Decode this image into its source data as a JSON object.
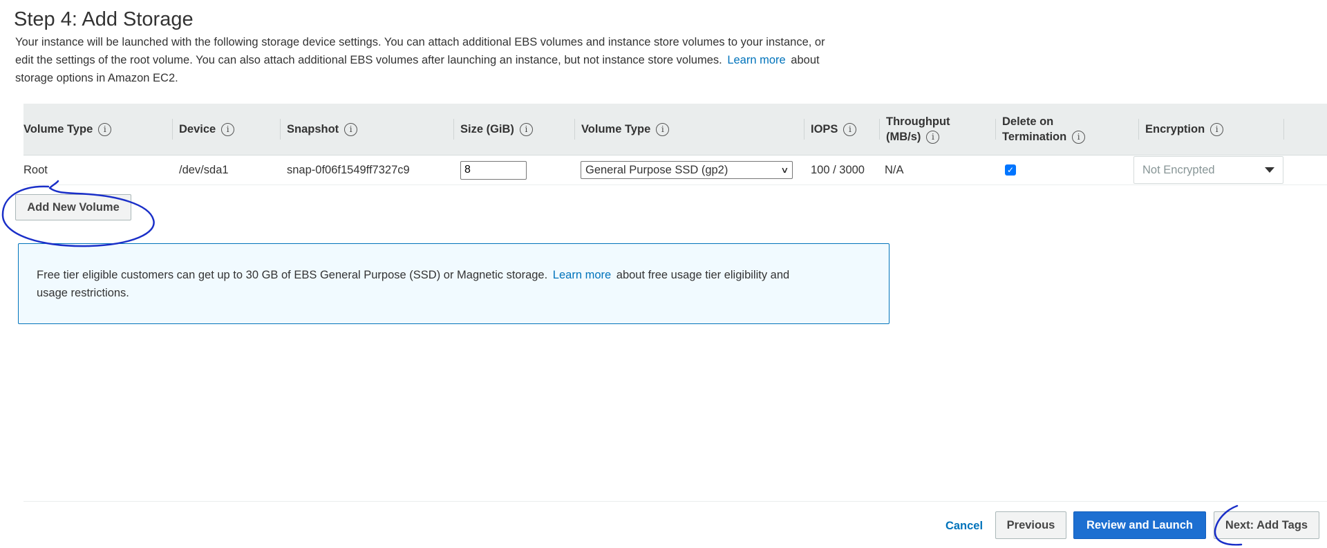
{
  "page": {
    "title": "Step 4: Add Storage",
    "intro": {
      "line1": "Your instance will be launched with the following storage device settings. You can attach additional EBS volumes and instance store volumes to your instance, or",
      "line2_before": "edit the settings of the root volume. You can also attach additional EBS volumes after launching an instance, but not instance store volumes.",
      "line2_link": "Learn more",
      "line2_after": "about",
      "line3": "storage options in Amazon EC2."
    }
  },
  "table": {
    "headers": {
      "volume_type": "Volume Type",
      "device": "Device",
      "snapshot": "Snapshot",
      "size": "Size (GiB)",
      "volume_type2": "Volume Type",
      "iops": "IOPS",
      "throughput_line1": "Throughput",
      "throughput_line2": "(MB/s)",
      "delete_line1": "Delete on",
      "delete_line2": "Termination",
      "encryption": "Encryption"
    },
    "rows": [
      {
        "volume_type": "Root",
        "device": "/dev/sda1",
        "snapshot": "snap-0f06f1549ff7327c9",
        "size": "8",
        "volume_type_selected": "General Purpose SSD (gp2)",
        "iops": "100 / 3000",
        "throughput": "N/A",
        "delete_on_termination": true,
        "encryption": "Not Encrypted"
      }
    ]
  },
  "add_volume_button": "Add New Volume",
  "free_tier": {
    "text_before": "Free tier eligible customers can get up to 30 GB of EBS General Purpose (SSD) or Magnetic storage.",
    "link": "Learn more",
    "text_after": "about free usage tier eligibility and",
    "line2": "usage restrictions."
  },
  "footer": {
    "cancel": "Cancel",
    "previous": "Previous",
    "review_launch": "Review and Launch",
    "next": "Next: Add Tags"
  },
  "icons": {
    "info": "info-icon",
    "select_chevron": "chevron-down-icon",
    "checkmark": "checkmark-icon",
    "dropdown_triangle": "triangle-down-icon"
  },
  "colors": {
    "link": "#0073bb",
    "primary_button": "#1d6fd1",
    "header_bg": "#eaeded",
    "info_box_bg": "#f1faff",
    "info_box_border": "#0073bb",
    "annotation_ink": "#1a2fc8"
  }
}
